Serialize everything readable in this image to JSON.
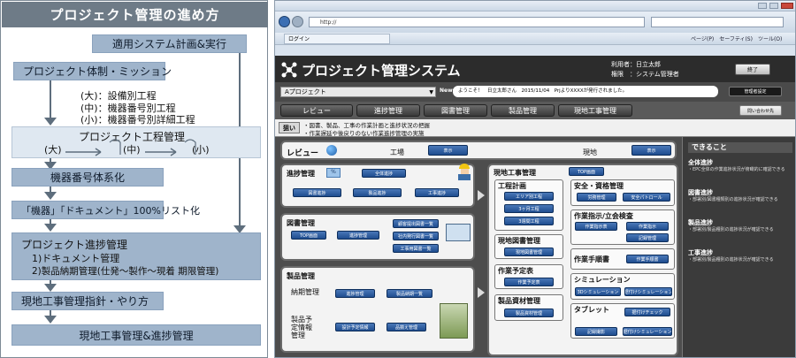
{
  "left_panel": {
    "title": "プロジェクト管理の進め方",
    "steps": {
      "apply_system": "適用システム計画&実行",
      "structure": "プロジェクト体制・ミッション",
      "notes": [
        "(大)：設備別工程",
        "(中)：機器番号別工程",
        "(小)：機器番号別詳細工程"
      ],
      "schedule_mgmt": "プロジェクト工程管理",
      "levels": [
        "(大)",
        "(中)",
        "(小)"
      ],
      "numbering": "機器番号体系化",
      "list100": "「機器」「ドキュメント」100%リスト化",
      "progress_title": "プロジェクト進捗管理",
      "progress_1": "1)ドキュメント管理",
      "progress_2": "2)製品納期管理(仕発〜製作〜現着 期限管理)",
      "site_instr": "現地工事管理指針・やり方",
      "site_progress": "現地工事管理&進捗管理"
    }
  },
  "browser": {
    "address": "http://",
    "tab_label": "ログイン",
    "toolbar_items": [
      "ページ(P)",
      "セーフティ(S)",
      "ツール(O)"
    ]
  },
  "app": {
    "title": "プロジェクト管理システム",
    "user_label": "利用者：日立太郎",
    "role_label": "権限　：システム管理者",
    "close_button": "終了",
    "project_select": "Aプロジェクト",
    "news_label": "News",
    "news_text": "ようこそ！　日立太郎さん　2015/11/04　PrjよりXXXXが発行されました。",
    "settings_button": "管理者設定",
    "tabs": [
      "レビュー",
      "進捗管理",
      "図書管理",
      "製品管理",
      "現地工事管理"
    ],
    "search_button": "問い合わせ先",
    "aim_label": "狙い",
    "aim_lines": [
      "・図書、製品、工事の作業計画と進捗状況の把握",
      "・作業遅延や後戻りのない作業進捗管理の実施"
    ]
  },
  "review": {
    "label": "レビュー",
    "site_factory": "工場",
    "site_field": "現地",
    "show_button": "表示"
  },
  "progress": {
    "label": "進捗管理",
    "buttons": [
      "全体進捗",
      "図書進捗",
      "製品進捗",
      "工事進捗"
    ]
  },
  "docs": {
    "label": "図書管理",
    "buttons": [
      "TOP画面",
      "進捗管理",
      "顧客提出図書一覧",
      "社内発行図書一覧",
      "工事用図書一覧"
    ]
  },
  "products": {
    "label": "製品管理",
    "sub1": "納期管理",
    "sub2": "製品予定情報管理",
    "buttons": [
      "進捗管理",
      "製品納期一覧",
      "設計予定情報",
      "品揃え管理"
    ]
  },
  "site": {
    "label": "現地工事管理",
    "top_button": "TOP画面",
    "schedule": {
      "label": "工程計画",
      "buttons": [
        "エリア別工程",
        "3ヶ月工程",
        "3週間工程"
      ]
    },
    "safety": {
      "label": "安全・資格管理",
      "buttons": [
        "労務管理",
        "安全パトロール"
      ]
    },
    "docs": {
      "label": "現地図書管理",
      "buttons": [
        "現地図書管理"
      ]
    },
    "instr": {
      "label": "作業指示/立会検査",
      "buttons": [
        "作業指示表",
        "作業指示",
        "記録管理"
      ]
    },
    "plan": {
      "label": "作業予定表",
      "buttons": [
        "作業予定表"
      ]
    },
    "proc": {
      "label": "作業手順書",
      "buttons": [
        "作業手順書"
      ]
    },
    "material": {
      "label": "製品資材管理",
      "buttons": [
        "製品資材管理"
      ]
    },
    "sim": {
      "label": "シミュレーション",
      "buttons": [
        "3Dシミュレーション",
        "据付けシミュレーション"
      ]
    },
    "tablet": {
      "label": "タブレット",
      "buttons": [
        "据付けチェック",
        "記録撮影",
        "据付けシミュレーション"
      ]
    }
  },
  "sidebar": {
    "title": "できること",
    "items": [
      {
        "head": "全体進捗",
        "desc": "・EPC全体の作業進捗状況が俯瞰的に確認できる"
      },
      {
        "head": "図書進捗",
        "desc": "・部署別/図書種類別の進捗状況が確認できる"
      },
      {
        "head": "製品進捗",
        "desc": "・部署別/製品種別の進捗状況が確認できる"
      },
      {
        "head": "工事進捗",
        "desc": "・部署別/製品種別の進捗状況が確認できる"
      }
    ]
  },
  "colors": {
    "flowbox": "#9fb4cb",
    "header_dark": "#2c2c2c",
    "button_blue": "#1f4d8f"
  }
}
